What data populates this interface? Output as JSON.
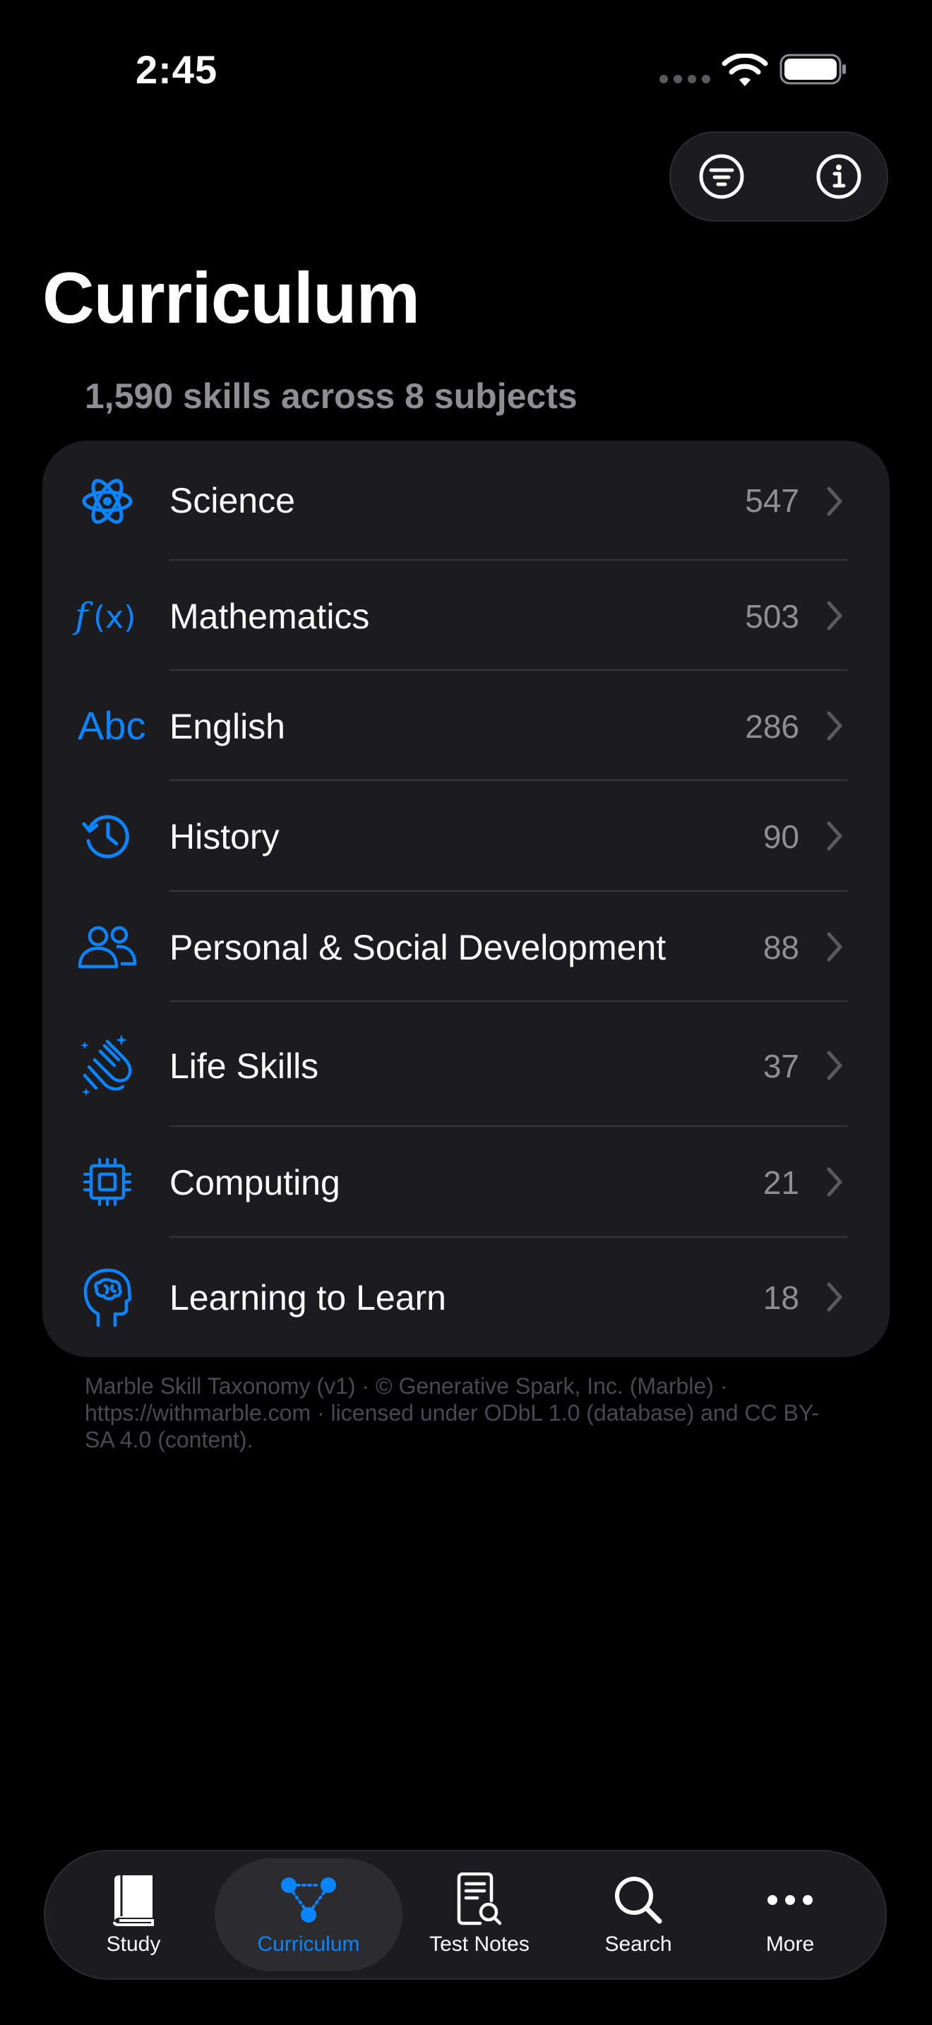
{
  "status_bar": {
    "time": "2:45"
  },
  "colors": {
    "accent": "#0a84ff",
    "background": "#000000",
    "card": "#1c1c1e",
    "secondary_text": "#8e8e93"
  },
  "toolbar": {
    "filter_icon": "filter-circle-icon",
    "info_icon": "info-circle-icon"
  },
  "header": {
    "title": "Curriculum",
    "summary": "1,590 skills across 8 subjects"
  },
  "subjects": [
    {
      "label": "Science",
      "count": "547",
      "icon": "atom-icon"
    },
    {
      "label": "Mathematics",
      "count": "503",
      "icon": "function-icon"
    },
    {
      "label": "English",
      "count": "286",
      "icon": "abc-icon"
    },
    {
      "label": "History",
      "count": "90",
      "icon": "clock-history-icon"
    },
    {
      "label": "Personal & Social Development",
      "count": "88",
      "icon": "people-icon"
    },
    {
      "label": "Life Skills",
      "count": "37",
      "icon": "clapping-hands-icon"
    },
    {
      "label": "Computing",
      "count": "21",
      "icon": "cpu-icon"
    },
    {
      "label": "Learning to Learn",
      "count": "18",
      "icon": "brain-head-icon"
    }
  ],
  "footer": {
    "note": "Marble Skill Taxonomy (v1) · © Generative Spark, Inc. (Marble) · https://withmarble.com · licensed under ODbL 1.0 (database) and CC BY-SA 4.0 (content)."
  },
  "tabs": [
    {
      "label": "Study",
      "icon": "book-icon",
      "selected": false
    },
    {
      "label": "Curriculum",
      "icon": "network-icon",
      "selected": true
    },
    {
      "label": "Test Notes",
      "icon": "document-search-icon",
      "selected": false
    },
    {
      "label": "Search",
      "icon": "search-icon",
      "selected": false
    },
    {
      "label": "More",
      "icon": "more-icon",
      "selected": false
    }
  ]
}
